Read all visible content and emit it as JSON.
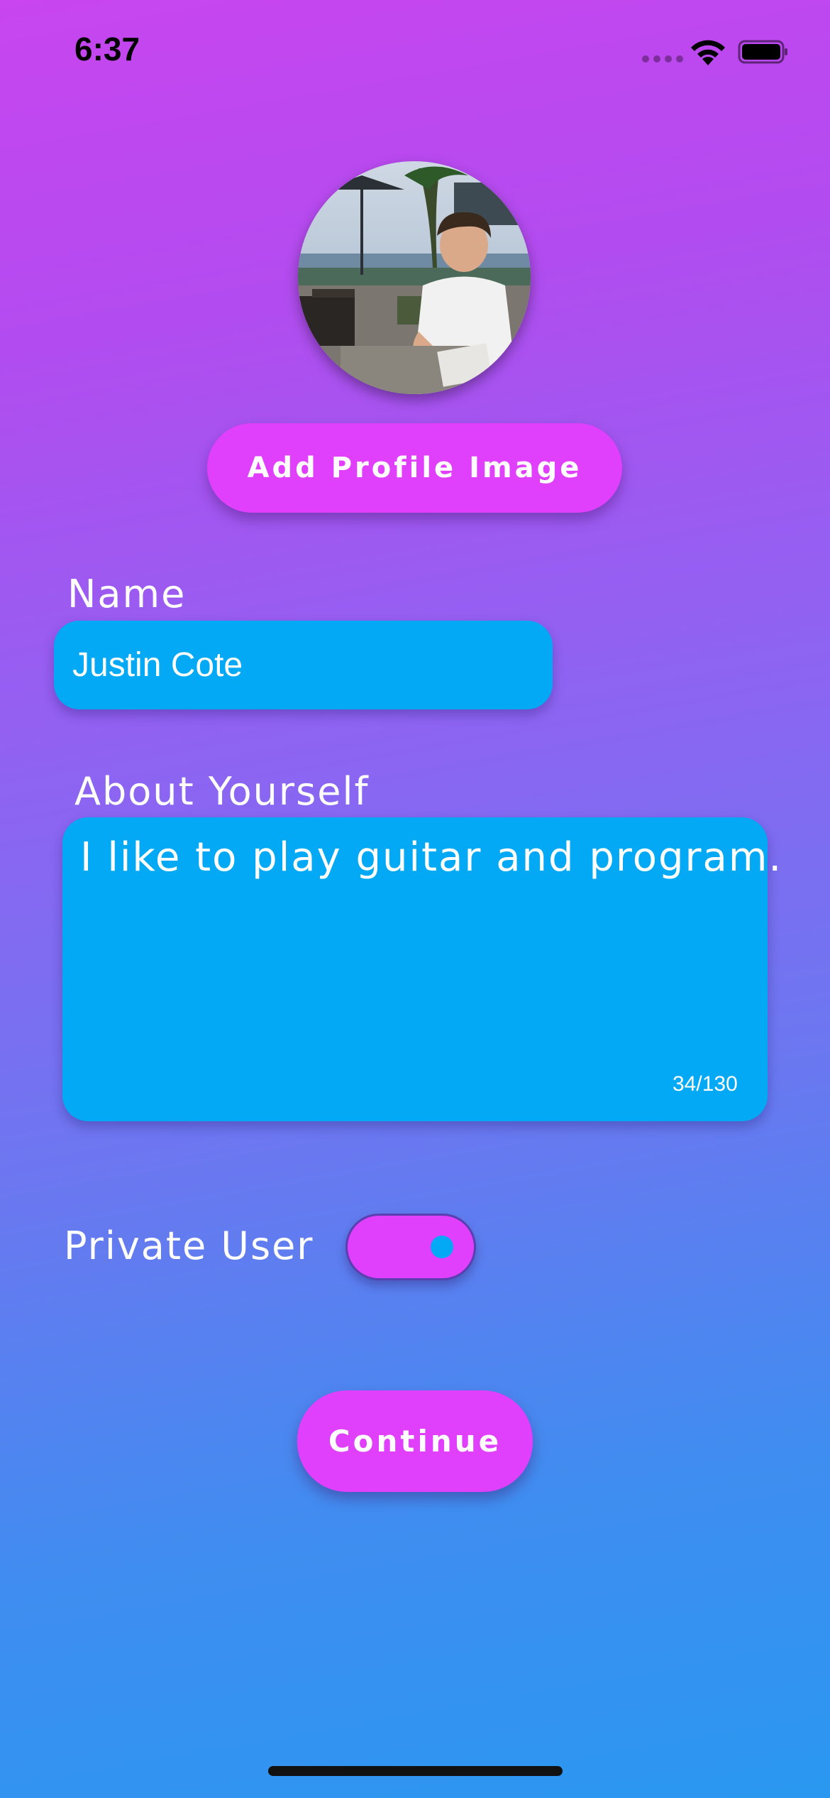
{
  "status_bar": {
    "time": "6:37",
    "icons": [
      "cellular-signal-icon",
      "wifi-icon",
      "battery-icon"
    ]
  },
  "profile": {
    "avatar_description_icon": "profile-photo",
    "add_image_label": "Add Profile Image"
  },
  "form": {
    "name_label": "Name",
    "name_value": "Justin Cote",
    "about_label": "About Yourself",
    "about_value": "I like to play guitar and program.",
    "about_counter": "34/130",
    "private_label": "Private User",
    "private_enabled": true
  },
  "actions": {
    "continue_label": "Continue"
  },
  "colors": {
    "accent_pink": "#e040fb",
    "field_blue": "#03a9f4",
    "gradient_top": "#c845ef",
    "gradient_bottom": "#2a98f0"
  }
}
